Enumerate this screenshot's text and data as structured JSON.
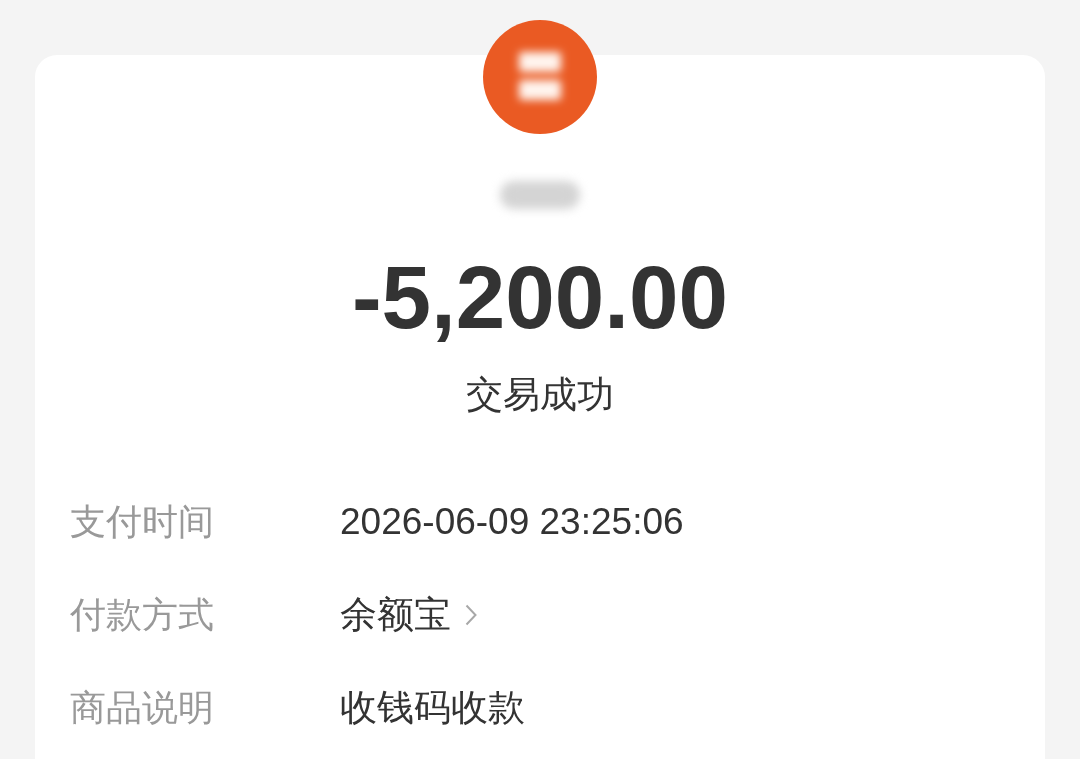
{
  "transaction": {
    "amount": "-5,200.00",
    "status": "交易成功"
  },
  "details": [
    {
      "kind": "text",
      "label": "支付时间",
      "value": "2026-06-09 23:25:06"
    },
    {
      "kind": "link",
      "label": "付款方式",
      "value": "余额宝"
    },
    {
      "kind": "text",
      "label": "商品说明",
      "value": "收钱码收款"
    }
  ]
}
